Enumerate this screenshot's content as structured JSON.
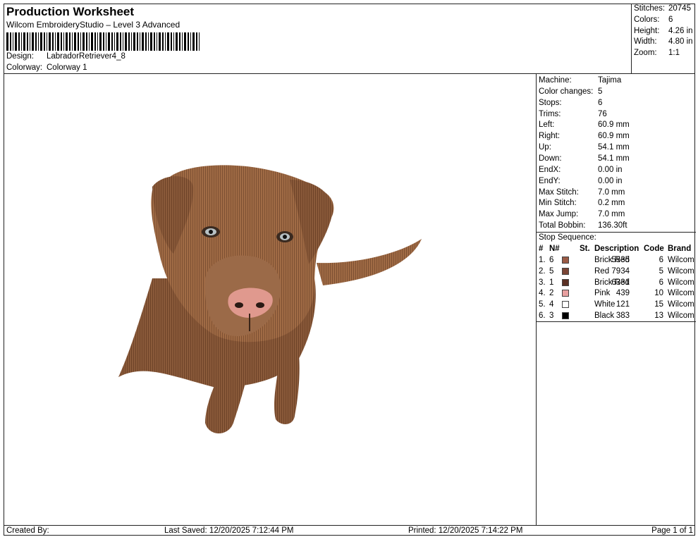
{
  "header": {
    "title": "Production Worksheet",
    "subtitle": "Wilcom EmbroideryStudio – Level 3 Advanced",
    "design_label": "Design:",
    "design_value": "LabradorRetriever4_8",
    "colorway_label": "Colorway:",
    "colorway_value": "Colorway 1"
  },
  "stats": {
    "stitches_label": "Stitches:",
    "stitches": "20745",
    "colors_label": "Colors:",
    "colors": "6",
    "height_label": "Height:",
    "height": "4.26 in",
    "width_label": "Width:",
    "width": "4.80 in",
    "zoom_label": "Zoom:",
    "zoom": "1:1"
  },
  "machine": {
    "machine_label": "Machine:",
    "machine": "Tajima",
    "color_changes_label": "Color changes:",
    "color_changes": "5",
    "stops_label": "Stops:",
    "stops": "6",
    "trims_label": "Trims:",
    "trims": "76",
    "left_label": "Left:",
    "left": "60.9 mm",
    "right_label": "Right:",
    "right": "60.9 mm",
    "up_label": "Up:",
    "up": "54.1 mm",
    "down_label": "Down:",
    "down": "54.1 mm",
    "endx_label": "EndX:",
    "endx": "0.00 in",
    "endy_label": "EndY:",
    "endy": "0.00 in",
    "max_stitch_label": "Max Stitch:",
    "max_stitch": "7.0 mm",
    "min_stitch_label": "Min Stitch:",
    "min_stitch": "0.2 mm",
    "max_jump_label": "Max Jump:",
    "max_jump": "7.0 mm",
    "total_bobbin_label": "Total Bobbin:",
    "total_bobbin": "136.30ft"
  },
  "sequence": {
    "title": "Stop Sequence:",
    "headers": {
      "num": "#",
      "n": "N#",
      "st": "St.",
      "desc": "Description",
      "code": "Code",
      "brand": "Brand"
    },
    "rows": [
      {
        "num": "1.",
        "n": "6",
        "color": "#9a5a45",
        "st": "5535",
        "desc": "Brick Red",
        "code": "6",
        "brand": "Wilcom"
      },
      {
        "num": "2.",
        "n": "5",
        "color": "#7a4535",
        "st": "7934",
        "desc": "Red",
        "code": "5",
        "brand": "Wilcom"
      },
      {
        "num": "3.",
        "n": "1",
        "color": "#5a3024",
        "st": "6331",
        "desc": "Brick Red",
        "code": "6",
        "brand": "Wilcom"
      },
      {
        "num": "4.",
        "n": "2",
        "color": "#e8a0a0",
        "st": "439",
        "desc": "Pink",
        "code": "10",
        "brand": "Wilcom"
      },
      {
        "num": "5.",
        "n": "4",
        "color": "#ffffff",
        "st": "121",
        "desc": "White",
        "code": "15",
        "brand": "Wilcom"
      },
      {
        "num": "6.",
        "n": "3",
        "color": "#000000",
        "st": "383",
        "desc": "Black",
        "code": "13",
        "brand": "Wilcom"
      }
    ]
  },
  "footer": {
    "created_by": "Created By:",
    "last_saved": "Last Saved: 12/20/2025 7:12:44 PM",
    "printed": "Printed: 12/20/2025 7:14:22 PM",
    "page": "Page 1 of 1"
  }
}
